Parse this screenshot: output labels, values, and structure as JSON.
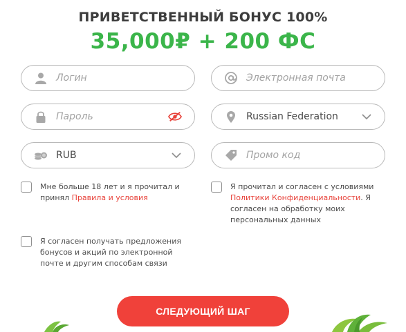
{
  "header": {
    "title": "ПРИВЕТСТВЕННЫЙ БОНУС 100%",
    "amount": "35,000₽ + 200 ФС"
  },
  "form": {
    "login_placeholder": "Логин",
    "email_placeholder": "Электронная почта",
    "password_placeholder": "Пароль",
    "country_value": "Russian Federation",
    "currency_value": "RUB",
    "promo_placeholder": "Промо код"
  },
  "consents": {
    "age_text_1": "Мне больше 18 лет и я прочитал и принял ",
    "age_link": "Правила и условия",
    "privacy_text_1": "Я прочитал и согласен с условиями ",
    "privacy_link": "Политики Конфиденциальности",
    "privacy_text_2": ". Я согласен на обработку моих персональных данных",
    "marketing_text": "Я согласен получать предложения бонусов и акций по электронной почте и другим способам связи"
  },
  "actions": {
    "next_label": "СЛЕДУЮЩИЙ ШАГ"
  },
  "colors": {
    "accent_green": "#3bb54a",
    "accent_red": "#f0413a",
    "border_gray": "#b9b9b9"
  },
  "icons": [
    "user-icon",
    "at-icon",
    "lock-icon",
    "eye-off-icon",
    "location-pin-icon",
    "chevron-down-icon",
    "coins-icon",
    "tag-icon"
  ]
}
